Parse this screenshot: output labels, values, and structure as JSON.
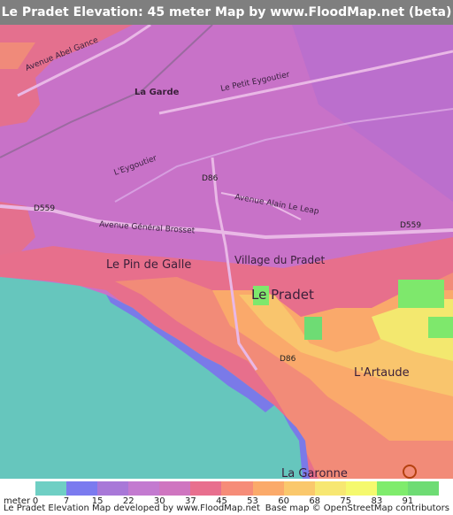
{
  "title": "Le Pradet Elevation: 45 meter Map by www.FloodMap.net (beta)",
  "places": {
    "la_garde": "La Garde",
    "le_pin_de_galle": "Le Pin de Galle",
    "le_pradet": "Le Pradet",
    "village_du_pradet": "Village du Pradet",
    "lartaude": "L'Artaude",
    "la_garonne": "La Garonne"
  },
  "roads": {
    "abel_gance": "Avenue Abel Gance",
    "petit_eygoutier": "Le Petit Eygoutier",
    "eygoutier": "L'Eygoutier",
    "d86_north": "D86",
    "d86_south": "D86",
    "alain_le_leap": "Avenue Alain Le Leap",
    "d559_west": "D559",
    "d559_east": "D559",
    "general_brosset": "Avenue Général Brosset"
  },
  "legend": {
    "unit_label": "meter",
    "ticks": [
      "0",
      "7",
      "15",
      "22",
      "30",
      "37",
      "45",
      "53",
      "60",
      "68",
      "75",
      "83",
      "91"
    ],
    "colors": [
      "#6fcfc4",
      "#7b7bef",
      "#a878d8",
      "#c37ad0",
      "#cf75c0",
      "#e86f8e",
      "#f68c78",
      "#fbaa6a",
      "#fac86c",
      "#f7e772",
      "#f5f96e",
      "#7fec6c",
      "#6edc74"
    ]
  },
  "credits": {
    "left": "Le Pradet Elevation Map developed by www.FloodMap.net",
    "right": "Base map © OpenStreetMap contributors"
  },
  "brand": {
    "logo_text": "FloodMap"
  }
}
